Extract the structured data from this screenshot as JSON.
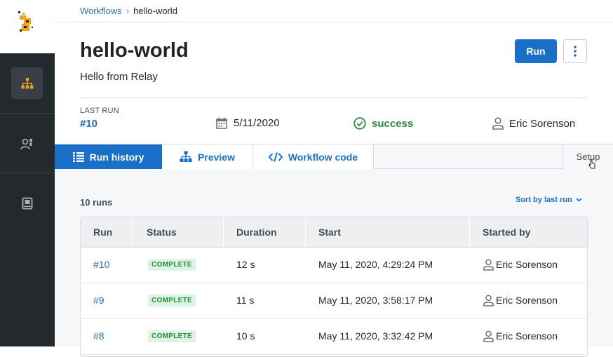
{
  "app": {
    "sidebar": [
      {
        "icon": "workflows-icon",
        "active": true
      },
      {
        "icon": "users-icon",
        "active": false
      },
      {
        "icon": "docs-icon",
        "active": false
      }
    ]
  },
  "breadcrumb": {
    "parent": "Workflows",
    "current": "hello-world"
  },
  "header": {
    "title": "hello-world",
    "description": "Hello from Relay",
    "run_label": "Run",
    "more_icon": "vertical-dots-icon"
  },
  "last_run": {
    "label": "LAST RUN",
    "number": "#10",
    "date": "5/11/2020",
    "status": "success",
    "user": "Eric Sorenson"
  },
  "tabs": [
    {
      "label": "Run history",
      "icon": "list-icon",
      "active": true
    },
    {
      "label": "Preview",
      "icon": "hierarchy-icon",
      "active": false
    },
    {
      "label": "Workflow code",
      "icon": "code-icon",
      "active": false
    },
    {
      "label": "Setup",
      "active": false
    }
  ],
  "runs": {
    "count_label": "10 runs",
    "sort_label": "Sort by last run",
    "columns": [
      "Run",
      "Status",
      "Duration",
      "Start",
      "Started by"
    ],
    "rows": [
      {
        "run": "#10",
        "status": "COMPLETE",
        "duration": "12 s",
        "start": "May 11, 2020, 4:29:24 PM",
        "started_by": "Eric Sorenson"
      },
      {
        "run": "#9",
        "status": "COMPLETE",
        "duration": "11 s",
        "start": "May 11, 2020, 3:58:17 PM",
        "started_by": "Eric Sorenson"
      },
      {
        "run": "#8",
        "status": "COMPLETE",
        "duration": "10 s",
        "start": "May 11, 2020, 3:32:42 PM",
        "started_by": "Eric Sorenson"
      }
    ]
  },
  "colors": {
    "primary": "#1a6fc9",
    "link": "#2e6db4",
    "success": "#2c8a3f",
    "sidebar": "#24292e",
    "accent": "#f0a21c"
  }
}
